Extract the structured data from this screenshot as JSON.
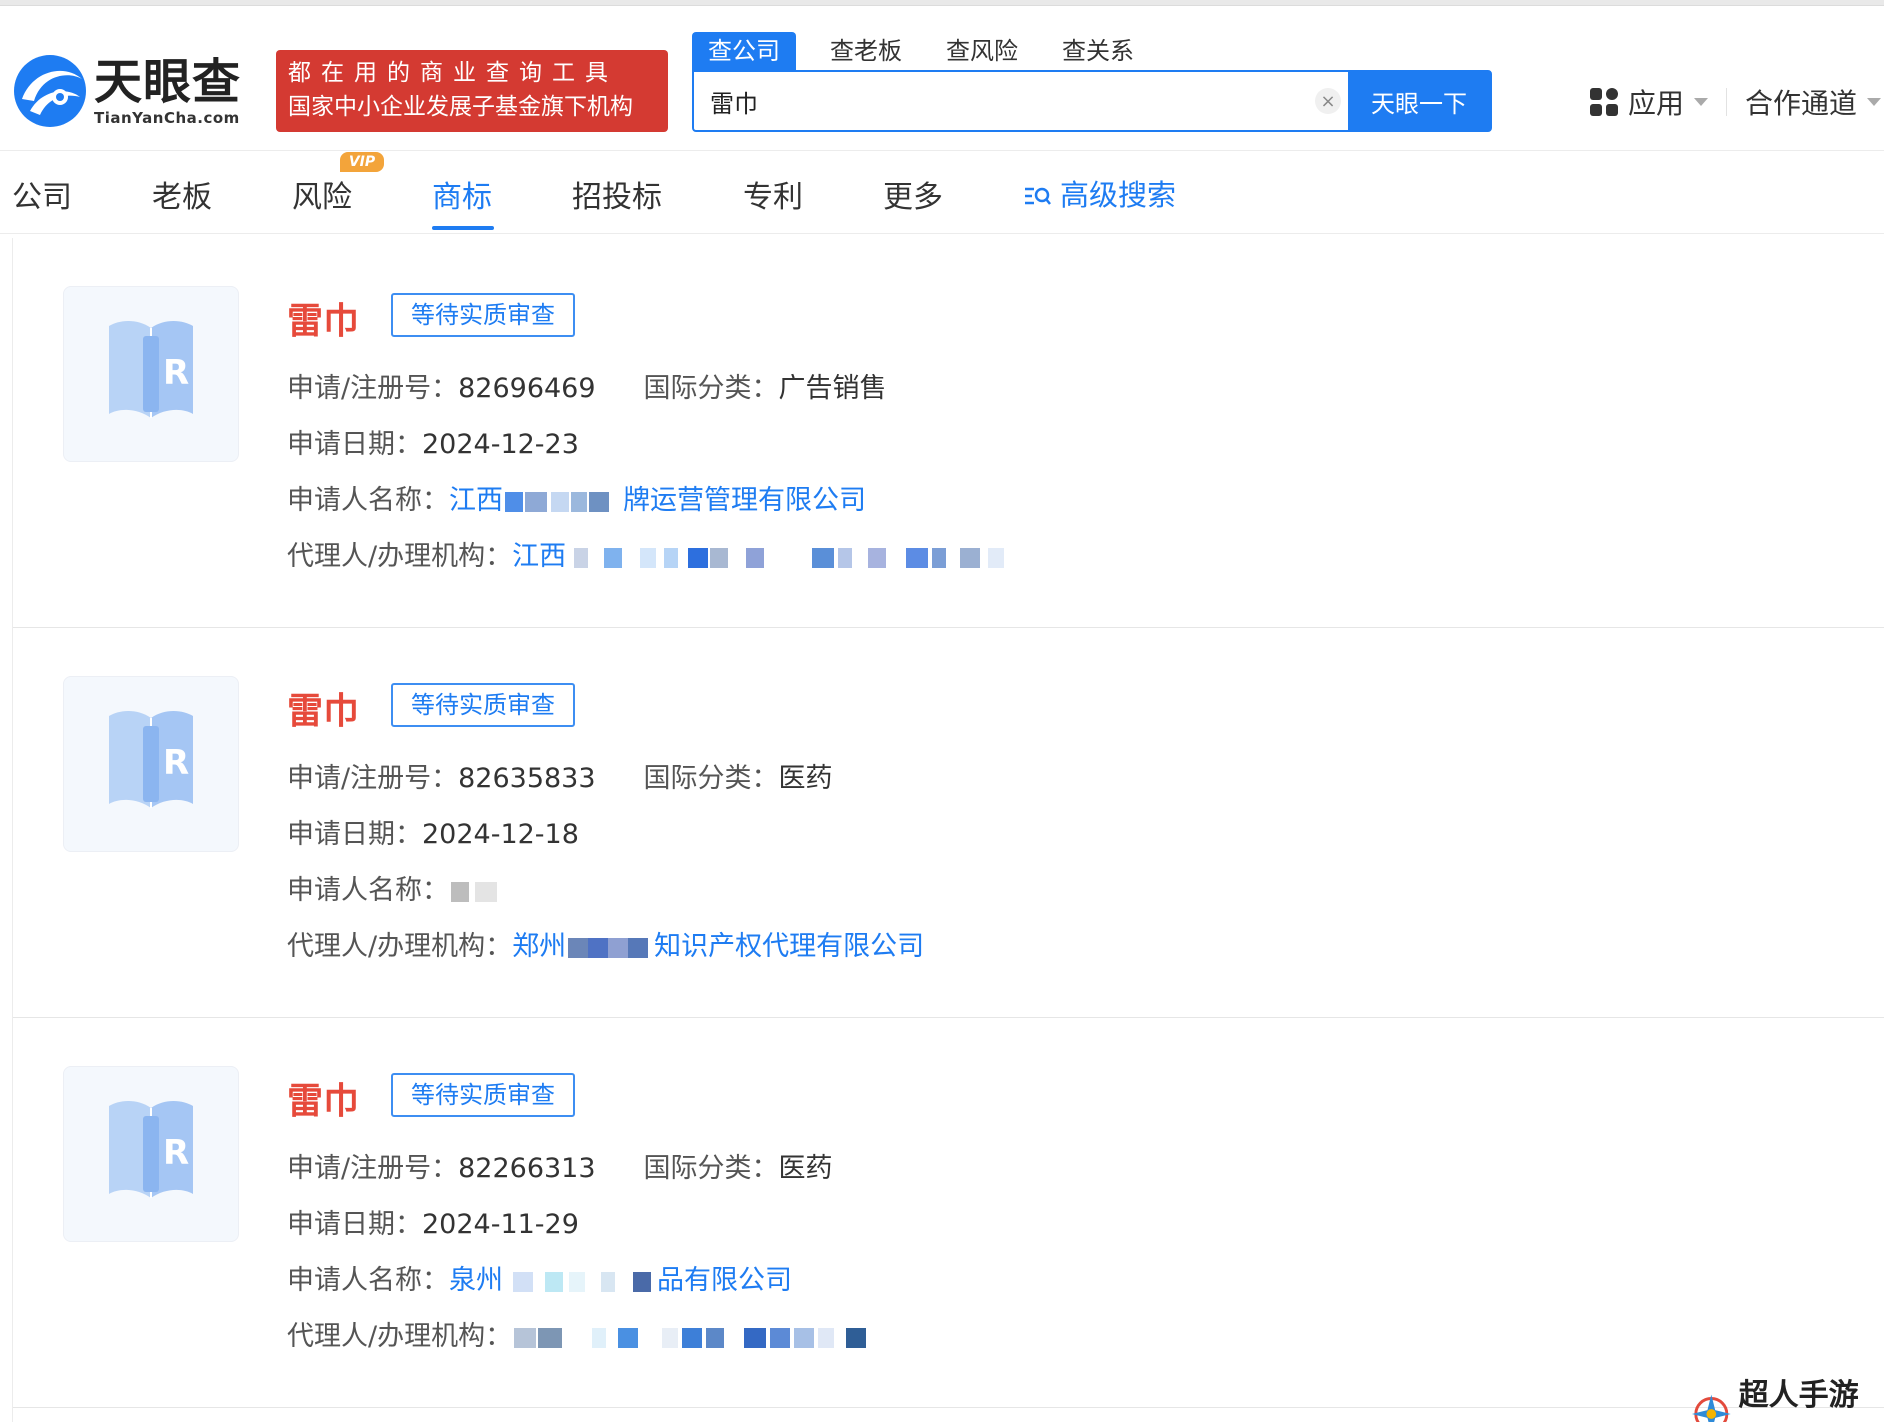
{
  "brand": {
    "name_cn": "天眼查",
    "name_en": "TianYanCha.com",
    "slogan_line1": "都在用的商业查询工具",
    "slogan_line2": "国家中小企业发展子基金旗下机构"
  },
  "search": {
    "tabs": [
      "查公司",
      "查老板",
      "查风险",
      "查关系"
    ],
    "query": "雷巾",
    "button_label": "天眼一下"
  },
  "header_right": {
    "apps_label": "应用",
    "partner_label": "合作通道"
  },
  "nav": {
    "items": [
      "公司",
      "老板",
      "风险",
      "商标",
      "招投标",
      "专利",
      "更多"
    ],
    "active": "商标",
    "vip_badge": "VIP",
    "advanced_search": "高级搜索"
  },
  "labels": {
    "reg_no": "申请/注册号：",
    "intl_class": "国际分类：",
    "apply_date": "申请日期：",
    "applicant": "申请人名称：",
    "agent": "代理人/办理机构："
  },
  "results": [
    {
      "name": "雷巾",
      "status": "等待实质审查",
      "reg_no": "82696469",
      "intl_class": "广告销售",
      "apply_date": "2024-12-23",
      "applicant_prefix": "江西",
      "applicant_suffix": "牌运营管理有限公司",
      "agent_prefix": "江西",
      "agent_suffix": ""
    },
    {
      "name": "雷巾",
      "status": "等待实质审查",
      "reg_no": "82635833",
      "intl_class": "医药",
      "apply_date": "2024-12-18",
      "applicant_prefix": "",
      "applicant_suffix": "",
      "agent_prefix": "郑州",
      "agent_suffix": "知识产权代理有限公司"
    },
    {
      "name": "雷巾",
      "status": "等待实质审查",
      "reg_no": "82266313",
      "intl_class": "医药",
      "apply_date": "2024-11-29",
      "applicant_prefix": "泉州",
      "applicant_suffix": "品有限公司",
      "agent_prefix": "",
      "agent_suffix": ""
    }
  ],
  "watermark": "超人手游网",
  "colors": {
    "accent": "#1e7cf2",
    "brand_red": "#d43a32",
    "title_red": "#e64a3b"
  }
}
